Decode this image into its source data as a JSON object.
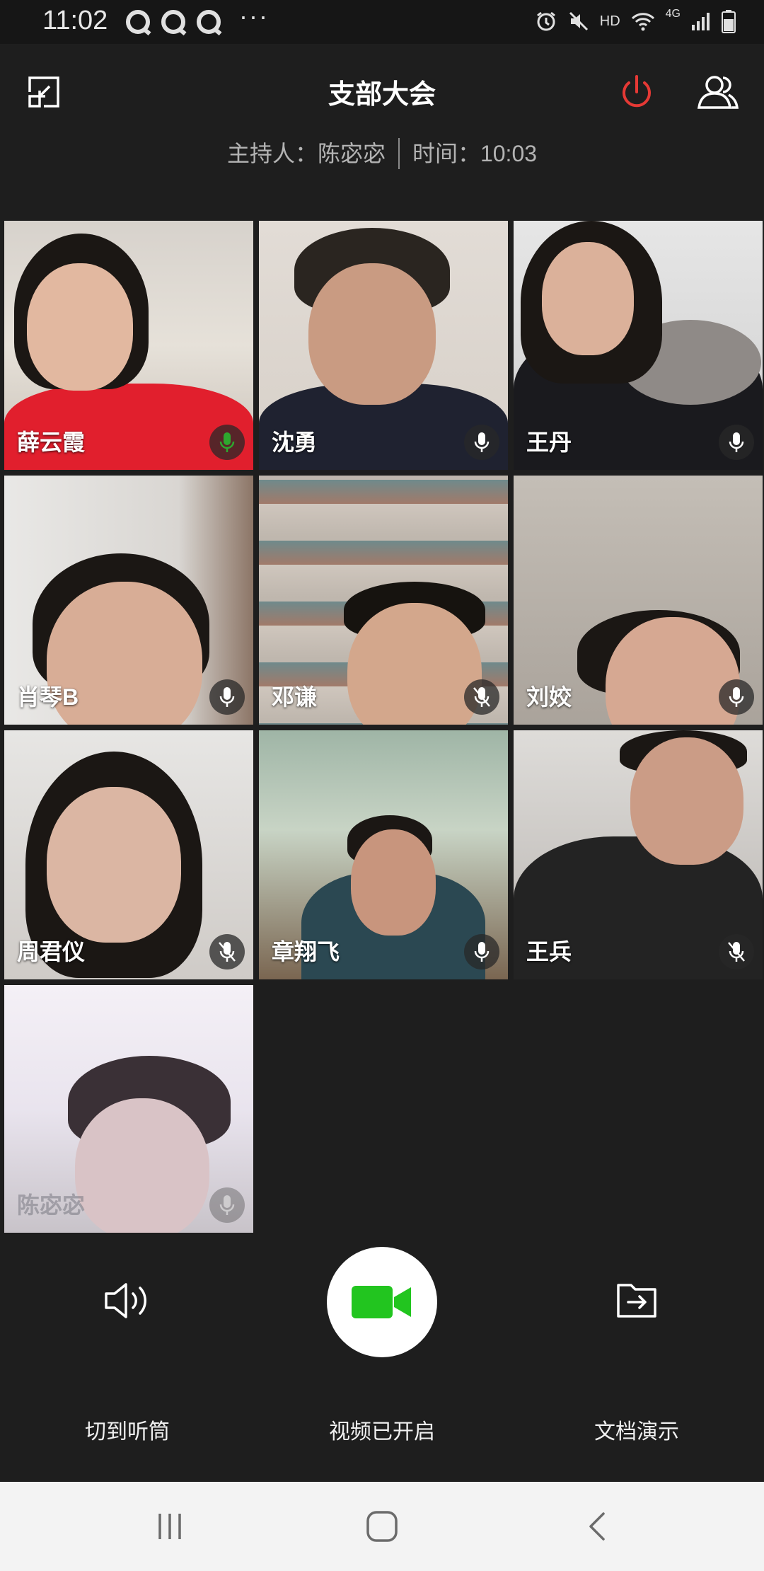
{
  "status_bar": {
    "time": "11:02",
    "more": "···",
    "network_label": "HD",
    "signal_label": "4G"
  },
  "header": {
    "title": "支部大会",
    "host": "主持人：陈宓宓",
    "time": "时间：10:03"
  },
  "participants": [
    {
      "name": "薛云霞",
      "mic": "speaking"
    },
    {
      "name": "沈勇",
      "mic": "on"
    },
    {
      "name": "王丹",
      "mic": "on"
    },
    {
      "name": "肖琴B",
      "mic": "on"
    },
    {
      "name": "邓谦",
      "mic": "muted"
    },
    {
      "name": "刘姣",
      "mic": "on"
    },
    {
      "name": "周君仪",
      "mic": "muted"
    },
    {
      "name": "章翔飞",
      "mic": "on"
    },
    {
      "name": "王兵",
      "mic": "muted"
    },
    {
      "name": "陈宓宓",
      "mic": "on"
    }
  ],
  "controls": {
    "speaker_label": "切到听筒",
    "video_label": "视频已开启",
    "doc_label": "文档演示"
  },
  "colors": {
    "background": "#1e1e1e",
    "leave_red": "#e53935",
    "video_green": "#22c51f",
    "speaking_green": "#2ea82e"
  }
}
